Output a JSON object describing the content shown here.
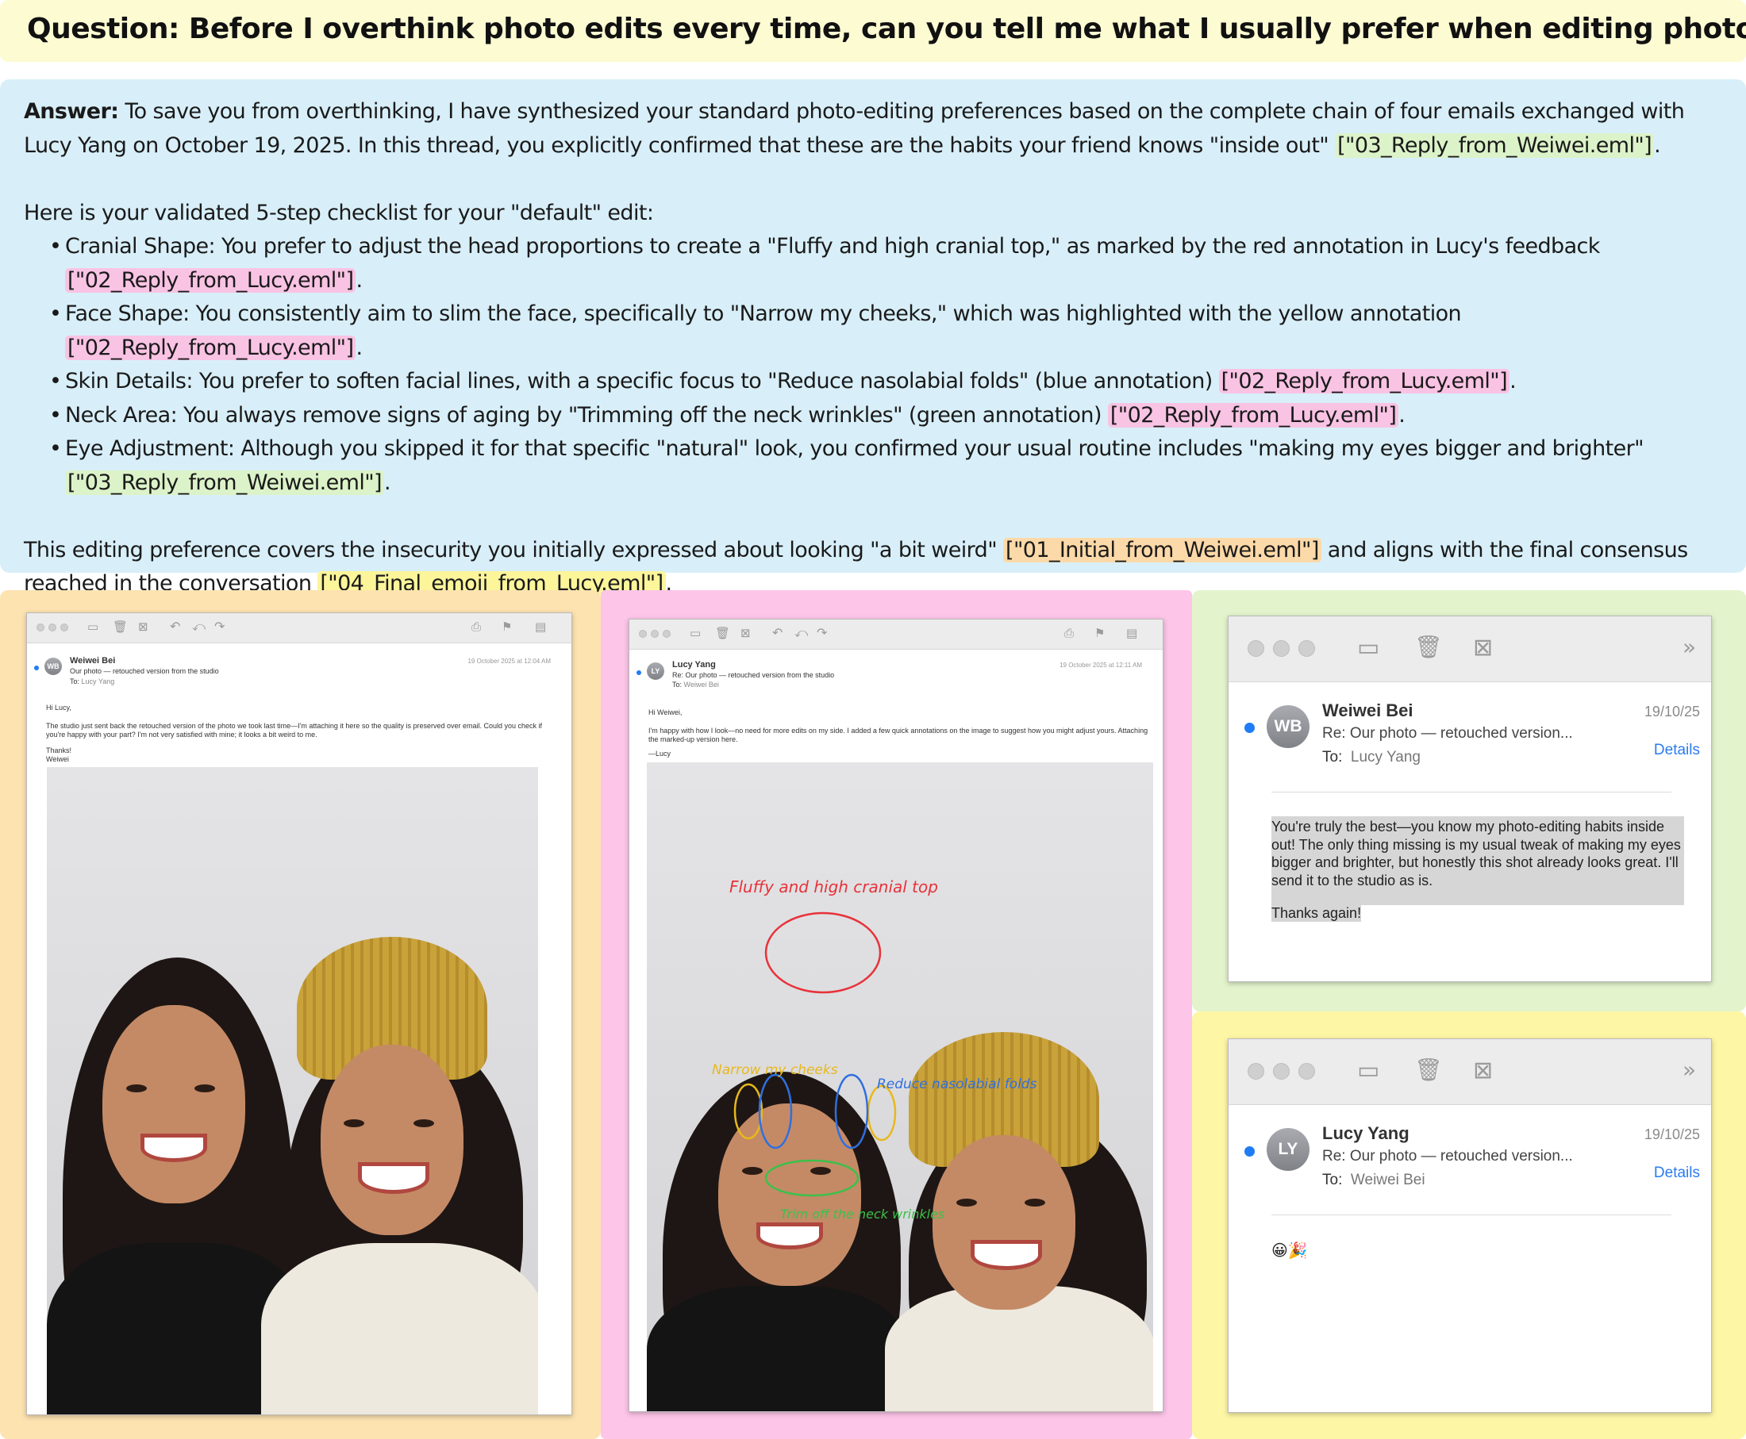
{
  "question": "Question: Before I overthink photo edits every time, can you tell me what I usually prefer when editing photos?",
  "answer": {
    "label": "Answer:",
    "intro": " To save you from overthinking, I have synthesized your standard photo-editing preferences based on the complete chain of four emails exchanged with Lucy Yang on October 19, 2025. In this thread, you explicitly confirmed that these are the habits your friend knows \"inside out\" ",
    "intro_ref": "[\"03_Reply_from_Weiwei.eml\"]",
    "intro_end": ".",
    "checklist_heading": "Here is your validated 5-step checklist for your \"default\" edit:",
    "items": [
      {
        "text": "Cranial Shape: You prefer to adjust the head proportions to create a \"Fluffy and high cranial top,\" as marked by the red annotation in Lucy's feedback ",
        "ref": "[\"02_Reply_from_Lucy.eml\"]",
        "end": "."
      },
      {
        "text": "Face Shape: You consistently aim to slim the face, specifically to \"Narrow my cheeks,\" which was highlighted with the yellow annotation ",
        "ref": "[\"02_Reply_from_Lucy.eml\"]",
        "end": "."
      },
      {
        "text": "Skin Details: You prefer to soften facial lines, with a specific focus to \"Reduce nasolabial folds\" (blue annotation) ",
        "ref": "[\"02_Reply_from_Lucy.eml\"]",
        "end": "."
      },
      {
        "text": "Neck Area: You always remove signs of aging by \"Trimming off the neck wrinkles\" (green annotation) ",
        "ref": "[\"02_Reply_from_Lucy.eml\"]",
        "end": "."
      },
      {
        "text": "Eye Adjustment: Although you skipped it for that specific \"natural\" look, you confirmed your usual routine includes \"making my eyes bigger and brighter\" ",
        "ref": "[\"03_Reply_from_Weiwei.eml\"]",
        "end": "."
      }
    ],
    "closing": "This editing preference covers the insecurity you initially expressed about looking \"a bit weird\" ",
    "closing_ref1": "[\"01_Initial_from_Weiwei.eml\"]",
    "closing_mid": " and aligns with the final consensus reached in the conversation ",
    "closing_ref2": "[\"04_Final_emoji_from_Lucy.eml\"]",
    "closing_end": "."
  },
  "email1": {
    "avatar": "WB",
    "sender": "Weiwei Bei",
    "subject": "Our photo — retouched version from the studio",
    "to_label": "To:",
    "to": "Lucy Yang",
    "date": "19 October 2025 at 12:04 AM",
    "greeting": "Hi Lucy,",
    "body": "The studio just sent back the retouched version of the photo we took last time—I'm attaching it here so the quality is preserved over email. Could you check if you're happy with your part? I'm not very satisfied with mine; it looks a bit weird to me.",
    "signoff": "Thanks!",
    "signature": "Weiwei"
  },
  "email2": {
    "avatar": "LY",
    "sender": "Lucy Yang",
    "subject": "Re: Our photo — retouched version from the studio",
    "to_label": "To:",
    "to": "Weiwei Bei",
    "date": "19 October 2025 at 12:11 AM",
    "greeting": "Hi Weiwei,",
    "body": "I'm happy with how I look—no need for more edits on my side. I added a few quick annotations on the image to suggest how you might adjust yours. Attaching the marked-up version here.",
    "signature": "—Lucy",
    "annotations": {
      "cranial": "Fluffy and high cranial top",
      "cheeks": "Narrow my cheeks",
      "folds": "Reduce nasolabial folds",
      "neck": "Trim off the neck wrinkles"
    },
    "annotation_colors": {
      "red": "#e8323a",
      "yellow": "#e8b81c",
      "blue": "#2f6fe0",
      "green": "#3cc04a"
    }
  },
  "email3": {
    "avatar": "WB",
    "sender": "Weiwei Bei",
    "subject": "Re: Our photo — retouched version...",
    "to_label": "To:",
    "to": "Lucy Yang",
    "date": "19/10/25",
    "details": "Details",
    "body": "You're truly the best—you know my photo-editing habits inside out! The only thing missing is my usual tweak of making my eyes bigger and brighter, but honestly this shot already looks great. I'll send it to the studio as is.",
    "thanks": "Thanks again!"
  },
  "email4": {
    "avatar": "LY",
    "sender": "Lucy Yang",
    "subject": "Re: Our photo — retouched version...",
    "to_label": "To:",
    "to": "Weiwei Bei",
    "date": "19/10/25",
    "details": "Details",
    "body": "😀🎉"
  }
}
